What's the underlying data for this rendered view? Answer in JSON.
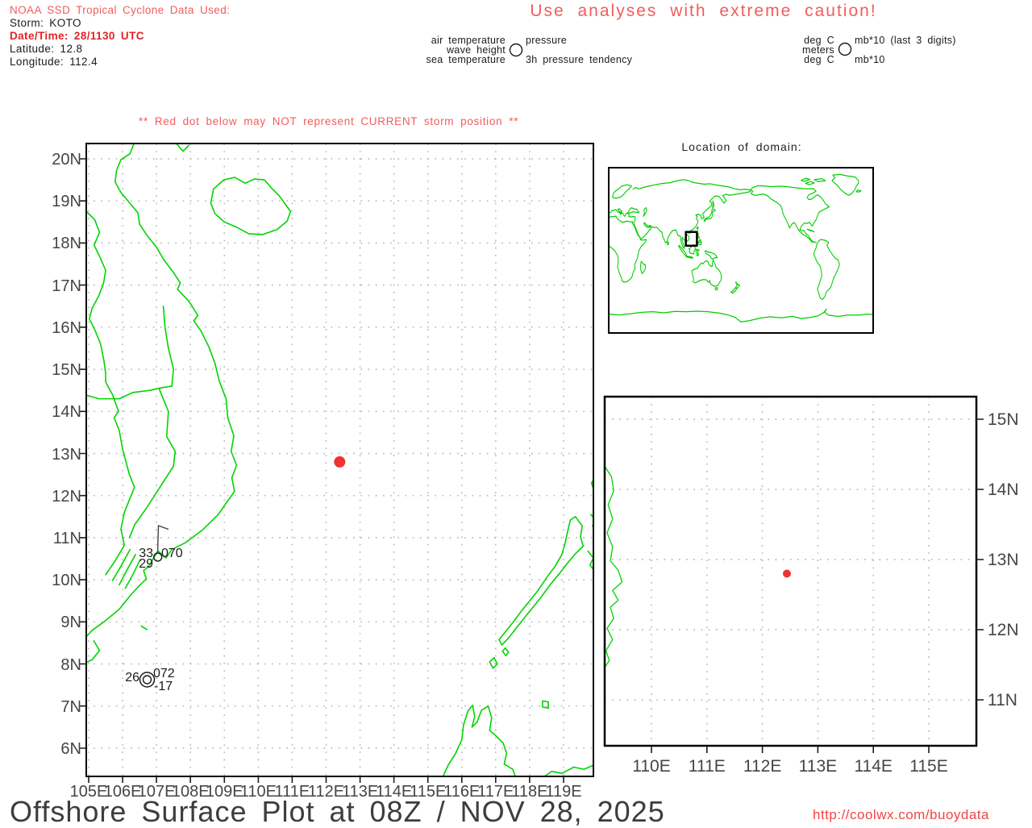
{
  "header": {
    "source_line": "NOAA SSD Tropical Cyclone Data Used:",
    "storm": "Storm: KOTO",
    "datetime": "Date/Time: 28/1130 UTC",
    "latitude": "Latitude: 12.8",
    "longitude": "Longitude: 112.4"
  },
  "caution_title": "Use analyses with extreme caution!",
  "station_model_legend": {
    "air_temp_label": "air temperature",
    "wave_height_label": "wave height",
    "sea_temp_label": "sea temperature",
    "pressure_label": "pressure",
    "tendency_label": "3h pressure tendency",
    "air_temp_units": "deg C",
    "wave_height_units": "meters",
    "sea_temp_units": "deg C",
    "pressure_units": "mb*10 (last 3 digits)",
    "tendency_units": "mb*10"
  },
  "warning_note": "** Red dot below may NOT represent CURRENT storm position **",
  "main_map": {
    "lat_labels": [
      "20N",
      "19N",
      "18N",
      "17N",
      "16N",
      "15N",
      "14N",
      "13N",
      "12N",
      "11N",
      "10N",
      "9N",
      "8N",
      "7N",
      "6N"
    ],
    "lon_labels": [
      "105E",
      "106E",
      "107E",
      "108E",
      "109E",
      "110E",
      "111E",
      "112E",
      "113E",
      "114E",
      "115E",
      "116E",
      "117E",
      "118E",
      "119E"
    ],
    "storm_dot": {
      "lon": "112.4",
      "lat": "12.8"
    },
    "stations": [
      {
        "air_temp": "33",
        "pressure": "070",
        "sea_temp": "29"
      },
      {
        "air_temp": "26",
        "pressure": "072",
        "tendency": "-17"
      }
    ]
  },
  "inset_map": {
    "title": "Location of domain:"
  },
  "zoom_map": {
    "lat_labels": [
      "15N",
      "14N",
      "13N",
      "12N",
      "11N"
    ],
    "lon_labels": [
      "110E",
      "111E",
      "112E",
      "113E",
      "114E",
      "115E"
    ]
  },
  "footer": {
    "title": "Offshore Surface Plot at 08Z / NOV 28, 2025",
    "url": "http://coolwx.com/buoydata"
  },
  "colors": {
    "coastline_green": "#00d400",
    "salmon_text": "#f25c5c",
    "alert_red": "#e32222",
    "storm_dot_red": "#ee3333",
    "grid_gray": "#b8b8b8"
  }
}
